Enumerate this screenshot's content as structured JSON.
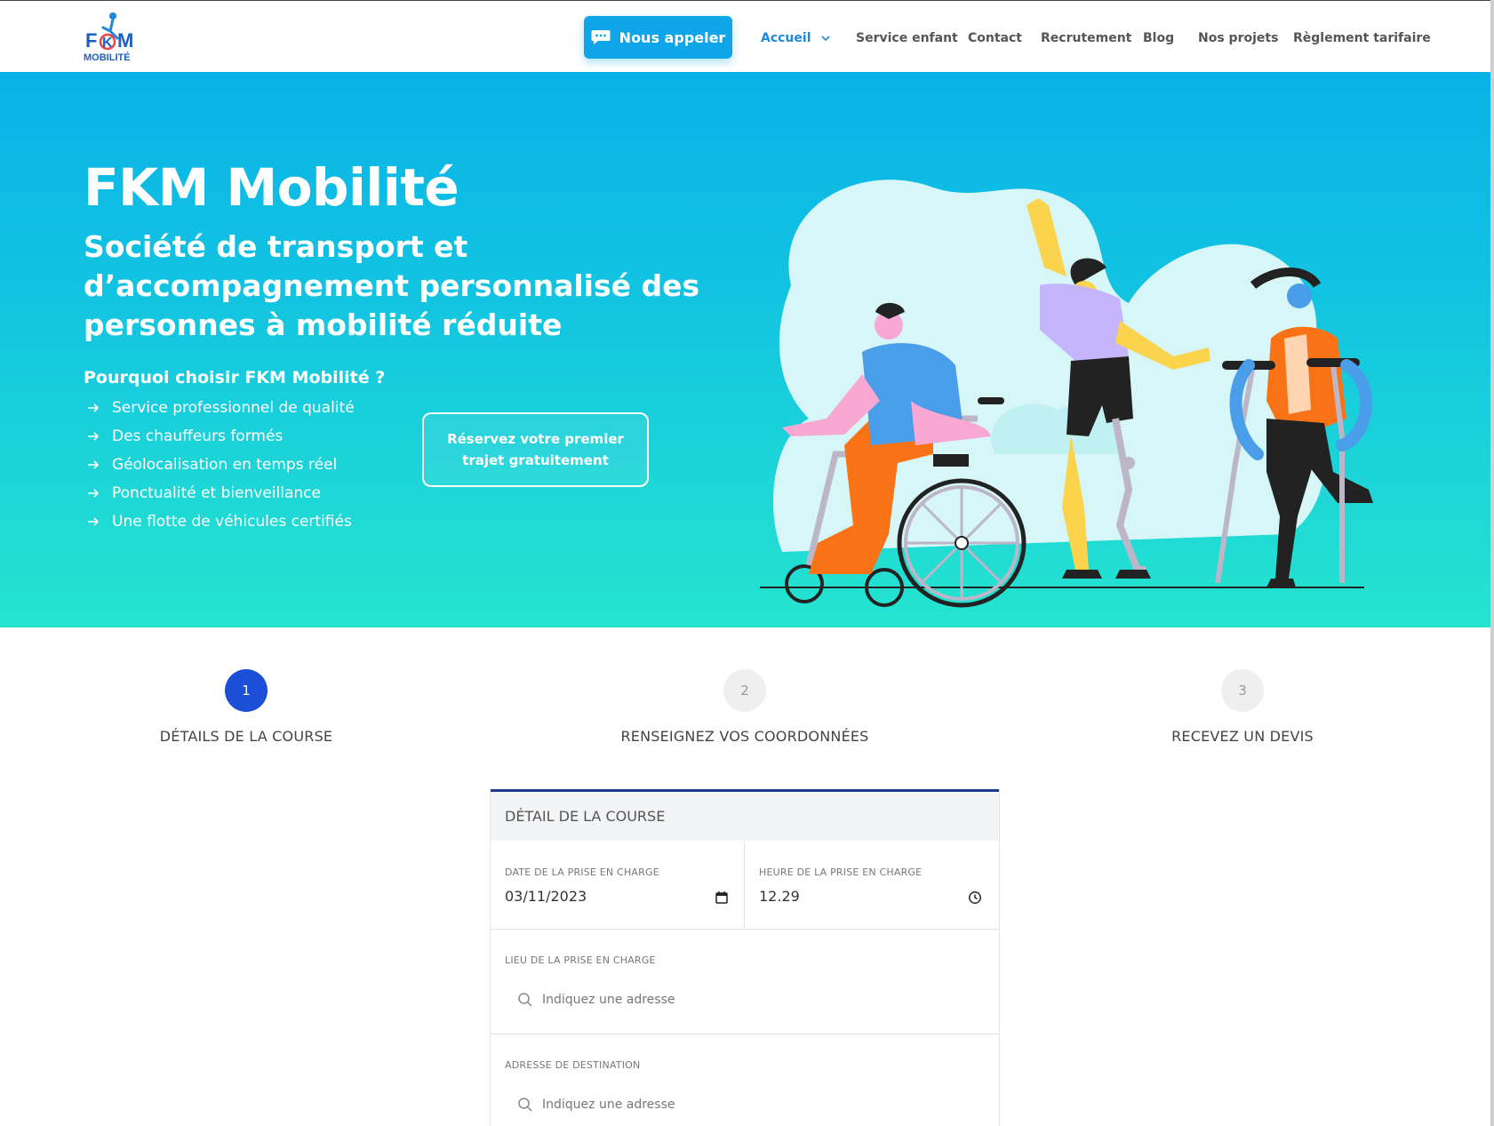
{
  "header": {
    "logo_text_top": "FKM",
    "logo_text_bottom": "MOBILITÉ",
    "call_button": "Nous appeler",
    "nav": [
      {
        "label": "Accueil",
        "active": true
      },
      {
        "label": "Service enfant"
      },
      {
        "label": "Contact"
      },
      {
        "label": "Recrutement"
      },
      {
        "label": "Blog"
      },
      {
        "label": "Nos projets"
      },
      {
        "label": "Règlement tarifaire"
      }
    ]
  },
  "hero": {
    "title": "FKM Mobilité",
    "subtitle": "Société de transport et d’accompagnement personnalisé des personnes à mobilité réduite",
    "why_title": "Pourquoi choisir FKM Mobilité ?",
    "features": [
      "Service professionnel de qualité",
      "Des chauffeurs formés",
      "Géolocalisation en temps réel",
      "Ponctualité et bienveillance",
      "Une flotte de véhicules certifiés"
    ],
    "cta": "Réservez votre premier trajet gratuitement"
  },
  "steps": [
    {
      "number": "1",
      "label": "DÉTAILS DE LA COURSE",
      "active": true
    },
    {
      "number": "2",
      "label": "RENSEIGNEZ VOS COORDONNÉES",
      "active": false
    },
    {
      "number": "3",
      "label": "RECEVEZ UN DEVIS",
      "active": false
    }
  ],
  "form": {
    "title": "DÉTAIL DE LA COURSE",
    "date_label": "DATE DE LA PRISE EN CHARGE",
    "date_value": "03/11/2023",
    "time_label": "HEURE DE LA PRISE EN CHARGE",
    "time_value": "12.29",
    "pickup_label": "LIEU DE LA PRISE EN CHARGE",
    "pickup_placeholder": "Indiquez une adresse",
    "dest_label": "ADRESSE DE DESTINATION",
    "dest_placeholder": "Indiquez une adresse"
  },
  "colors": {
    "primary_blue": "#0ea5e9",
    "step_active": "#1d4ed8",
    "hero_top": "#08b2e8",
    "hero_bottom": "#25e4cf"
  }
}
